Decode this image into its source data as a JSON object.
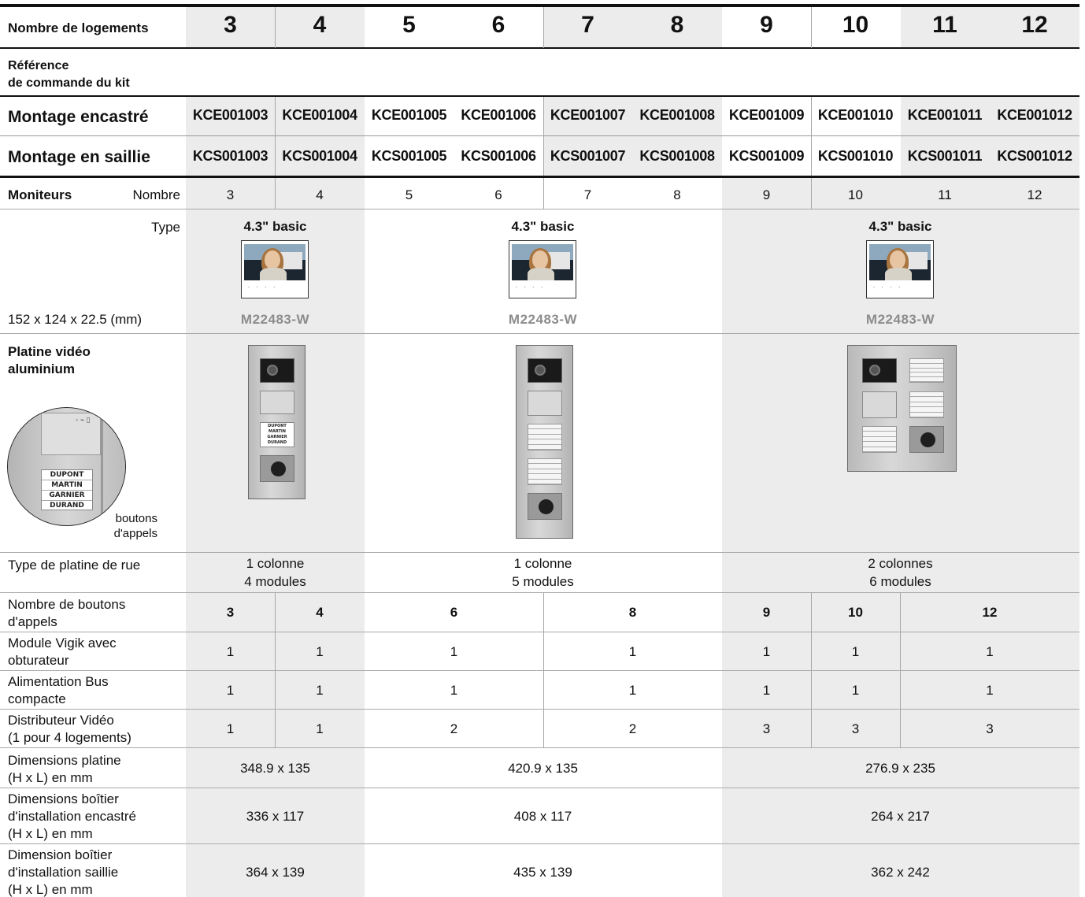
{
  "header": {
    "label": "Nombre de logements",
    "columns": [
      "3",
      "4",
      "5",
      "6",
      "7",
      "8",
      "9",
      "10",
      "11",
      "12"
    ]
  },
  "ref_section": {
    "label_line1": "Référence",
    "label_line2": "de commande du kit"
  },
  "encastre": {
    "label": "Montage encastré",
    "refs": [
      "KCE001003",
      "KCE001004",
      "KCE001005",
      "KCE001006",
      "KCE001007",
      "KCE001008",
      "KCE001009",
      "KCE001010",
      "KCE001011",
      "KCE001012"
    ]
  },
  "saillie": {
    "label": "Montage en saillie",
    "refs": [
      "KCS001003",
      "KCS001004",
      "KCS001005",
      "KCS001006",
      "KCS001007",
      "KCS001008",
      "KCS001009",
      "KCS001010",
      "KCS001011",
      "KCS001012"
    ]
  },
  "moniteurs": {
    "label": "Moniteurs",
    "nombre_label": "Nombre",
    "nombre": [
      "3",
      "4",
      "5",
      "6",
      "7",
      "8",
      "9",
      "10",
      "11",
      "12"
    ],
    "type_label": "Type",
    "dims_label": "152 x 124 x 22.5 (mm)",
    "types": [
      {
        "name": "4.3\" basic",
        "ref": "M22483-W"
      },
      {
        "name": "4.3\" basic",
        "ref": "M22483-W"
      },
      {
        "name": "4.3\" basic",
        "ref": "M22483-W"
      }
    ]
  },
  "platine": {
    "label_line1": "Platine vidéo",
    "label_line2": "aluminium",
    "names": [
      "DUPONT",
      "MARTIN",
      "GARNIER",
      "DURAND"
    ],
    "callout_line1": "boutons",
    "callout_line2": "d'appels"
  },
  "type_platine": {
    "label": "Type de platine de rue",
    "groups": [
      {
        "line1": "1 colonne",
        "line2": "4 modules"
      },
      {
        "line1": "1 colonne",
        "line2": "5 modules"
      },
      {
        "line1": "2 colonnes",
        "line2": "6 modules"
      }
    ]
  },
  "boutons": {
    "label_line1": "Nombre de boutons",
    "label_line2": "d'appels",
    "values": [
      "3",
      "4",
      "6",
      "8",
      "9",
      "10",
      "12"
    ]
  },
  "vigik": {
    "label_line1": "Module Vigik avec",
    "label_line2": "obturateur",
    "values": [
      "1",
      "1",
      "1",
      "1",
      "1",
      "1",
      "1"
    ]
  },
  "alimentation": {
    "label_line1": "Alimentation Bus",
    "label_line2": "compacte",
    "values": [
      "1",
      "1",
      "1",
      "1",
      "1",
      "1",
      "1"
    ]
  },
  "distributeur": {
    "label_line1": "Distributeur Vidéo",
    "label_line2": "(1 pour 4 logements)",
    "values": [
      "1",
      "1",
      "2",
      "2",
      "3",
      "3",
      "3"
    ]
  },
  "dim_platine": {
    "label_line1": "Dimensions platine",
    "label_line2": "(H x L) en mm",
    "values": [
      "348.9 x 135",
      "420.9 x 135",
      "276.9 x 235"
    ]
  },
  "dim_encastre": {
    "label_line1": "Dimensions boîtier",
    "label_line2": "d'installation encastré",
    "label_line3": "(H x L) en mm",
    "values": [
      "336 x 117",
      "408 x 117",
      "264 x 217"
    ]
  },
  "dim_saillie": {
    "label_line1": "Dimension boîtier",
    "label_line2": "d'installation saillie",
    "label_line3": "(H x L) en mm",
    "values": [
      "364 x 139",
      "435 x 139",
      "362 x 242"
    ]
  },
  "colors": {
    "shade": "#ececec",
    "rule": "#111111",
    "muted": "#8c8c8c"
  }
}
